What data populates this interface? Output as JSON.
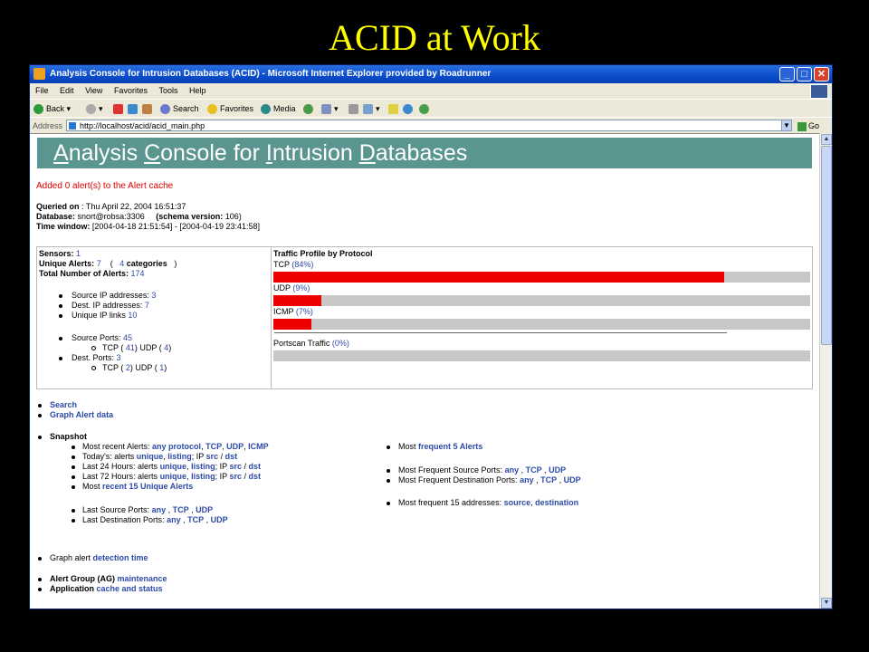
{
  "slide": {
    "title": "ACID at Work"
  },
  "window": {
    "title": "Analysis Console for Intrusion Databases (ACID) - Microsoft Internet Explorer provided by Roadrunner",
    "controls": {
      "minimize": "_",
      "maximize": "□",
      "close": "✕"
    }
  },
  "menu": {
    "items": [
      "File",
      "Edit",
      "View",
      "Favorites",
      "Tools",
      "Help"
    ]
  },
  "toolbar": {
    "back": "Back",
    "search": "Search",
    "favorites": "Favorites",
    "media": "Media"
  },
  "address": {
    "label": "Address",
    "url": "http://localhost/acid/acid_main.php",
    "go": "Go"
  },
  "page": {
    "banner": {
      "a": "A",
      "nalysis": "nalysis ",
      "c": "C",
      "onsole": "onsole for ",
      "i": "I",
      "ntrusion": "ntrusion ",
      "d": "D",
      "atabases": "atabases"
    },
    "message": "Added 0 alert(s) to the Alert cache",
    "queried_label": "Queried on",
    "queried_value": " : Thu April 22, 2004 16:51:37",
    "database_label": "Database:",
    "database_value": " snort@robsa:3306",
    "schema_label": "(schema version:",
    "schema_value": " 106)",
    "time_label": "Time window:",
    "time_value": " [2004-04-18 21:51:54] - [2004-04-19 23:41:58]"
  },
  "stats": {
    "sensors_label": "Sensors:",
    "sensors_value": "1",
    "unique_label": "Unique Alerts:",
    "unique_value": "7",
    "unique_open": "(",
    "categories_value": "4",
    "categories_label": "categories",
    "unique_close": ")",
    "total_label": "Total Number of Alerts:",
    "total_value": "174",
    "src_ip_label": "Source IP addresses:",
    "src_ip_value": "3",
    "dst_ip_label": "Dest. IP addresses:",
    "dst_ip_value": "7",
    "unique_links_label": "Unique IP links",
    "unique_links_value": "10",
    "src_ports_label": "Source Ports:",
    "src_ports_value": "45",
    "src_tcp_label": "TCP (",
    "src_tcp_value": "41",
    "src_udp_label": ")  UDP (",
    "src_udp_value": "4",
    "src_close": ")",
    "dst_ports_label": "Dest. Ports:",
    "dst_ports_value": "3",
    "dst_tcp_label": "TCP (",
    "dst_tcp_value": "2",
    "dst_udp_label": ")  UDP (",
    "dst_udp_value": "1",
    "dst_close": ")"
  },
  "traffic": {
    "title": "Traffic Profile by Protocol",
    "protocols": [
      {
        "name": "TCP",
        "pct_text": "(84%)",
        "fraction": 0.84
      },
      {
        "name": "UDP",
        "pct_text": "(9%)",
        "fraction": 0.09
      },
      {
        "name": "ICMP",
        "pct_text": "(7%)",
        "fraction": 0.07
      }
    ],
    "portscan": {
      "name": "Portscan Traffic",
      "pct_text": "(0%)",
      "fraction": 0
    }
  },
  "links": {
    "search": "Search",
    "graph": "Graph Alert data",
    "snapshot": "Snapshot",
    "recent_label": "Most recent Alerts:",
    "recent_any": "any protocol",
    "recent_tcp": "TCP",
    "recent_udp": "UDP",
    "recent_icmp": "ICMP",
    "today_label": "Today's: alerts",
    "today_unique": "unique",
    "today_listing": "listing",
    "today_ip": "; IP",
    "today_src": "src",
    "today_dst": "dst",
    "h24_label": "Last 24 Hours: alerts",
    "h24_unique": "unique",
    "h24_listing": "listing",
    "h24_ip": "; IP",
    "h24_src": "src",
    "h24_dst": "dst",
    "h72_label": "Last 72 Hours: alerts",
    "h72_unique": "unique",
    "h72_listing": "listing",
    "h72_ip": "; IP",
    "h72_src": "src",
    "h72_dst": "dst",
    "most_label": "Most",
    "most_recent15": "recent 15 Unique Alerts",
    "last_src_label": "Last Source Ports:",
    "last_src_any": "any",
    "last_src_tcp": "TCP",
    "last_src_udp": "UDP",
    "last_dst_label": "Last Destination Ports:",
    "last_dst_any": "any",
    "last_dst_tcp": "TCP",
    "last_dst_udp": "UDP",
    "most_freq5_label": "Most",
    "most_freq5": "frequent 5 Alerts",
    "freq_src_label": "Most Frequent Source Ports:",
    "freq_src_any": "any",
    "freq_src_tcp": "TCP",
    "freq_src_udp": "UDP",
    "freq_dst_label": "Most Frequent Destination Ports:",
    "freq_dst_any": "any",
    "freq_dst_tcp": "TCP",
    "freq_dst_udp": "UDP",
    "freq15_label": "Most frequent 15 addresses:",
    "freq15_src": "source",
    "freq15_dst": "destination",
    "graph_time_label": "Graph alert",
    "graph_time_link": "detection time",
    "ag_label": "Alert Group (AG)",
    "ag_link": "maintenance",
    "app_label": "Application",
    "app_link": "cache and status"
  }
}
